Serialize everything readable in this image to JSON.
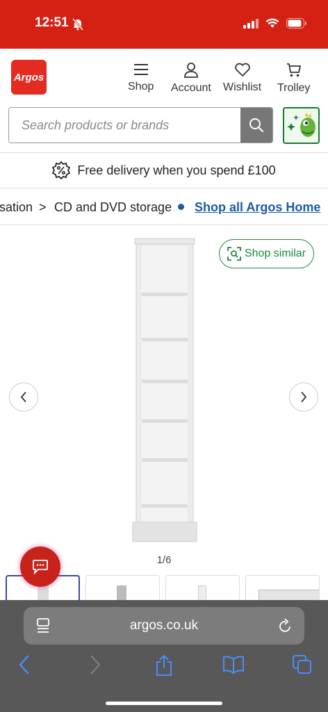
{
  "status": {
    "time": "12:51"
  },
  "brand": {
    "logo_text": "Argos",
    "color": "#e52a1f"
  },
  "nav": {
    "shop": "Shop",
    "account": "Account",
    "wishlist": "Wishlist",
    "trolley": "Trolley"
  },
  "search": {
    "placeholder": "Search products or brands"
  },
  "delivery": {
    "text": "Free delivery when you spend £100"
  },
  "breadcrumb": {
    "prev_partial": "sation",
    "separator": ">",
    "current": "CD and DVD storage",
    "link": "Shop all Argos Home"
  },
  "gallery": {
    "shop_similar": "Shop similar",
    "counter": "1/6",
    "thumbnails": 4
  },
  "browser": {
    "url": "argos.co.uk"
  },
  "colors": {
    "accent_red": "#d42114",
    "link_blue": "#1a5aa6",
    "green": "#1a8a3c"
  }
}
